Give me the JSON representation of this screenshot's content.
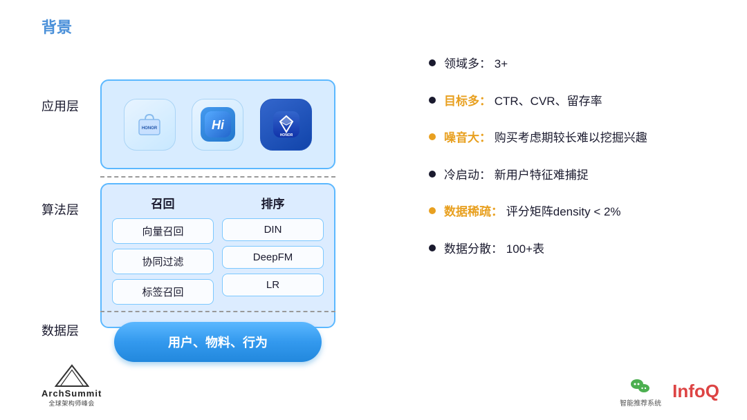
{
  "title": "背景",
  "layers": {
    "app": {
      "label": "应用层",
      "icons": [
        {
          "id": "honor-shop",
          "text": "HONOR",
          "style": "light"
        },
        {
          "id": "hihonor",
          "text": "Hi",
          "style": "blue"
        },
        {
          "id": "honor-diamond",
          "text": "HONOR",
          "style": "dark"
        }
      ]
    },
    "algo": {
      "label": "算法层",
      "recall": {
        "title": "召回",
        "items": [
          "向量召回",
          "协同过滤",
          "标签召回"
        ]
      },
      "rank": {
        "title": "排序",
        "items": [
          "DIN",
          "DeepFM",
          "LR"
        ]
      }
    },
    "data": {
      "label": "数据层",
      "content": "用户、物料、行为"
    }
  },
  "bullets": [
    {
      "id": "domains",
      "dot_color": "dark",
      "highlight": "",
      "prefix": "领域多：",
      "value": "3+"
    },
    {
      "id": "targets",
      "dot_color": "dark",
      "highlight": "orange",
      "prefix": "目标多：",
      "value": "CTR、CVR、留存率"
    },
    {
      "id": "noise",
      "dot_color": "orange",
      "highlight": "orange",
      "prefix": "噪音大：",
      "value": "购买考虑期较长难以挖掘兴趣"
    },
    {
      "id": "cold-start",
      "dot_color": "dark",
      "highlight": "",
      "prefix": "冷启动：",
      "value": "新用户特征难捕捉"
    },
    {
      "id": "sparse",
      "dot_color": "orange",
      "highlight": "orange",
      "prefix": "数据稀疏：",
      "value": "评分矩阵density < 2%"
    },
    {
      "id": "scattered",
      "dot_color": "dark",
      "highlight": "",
      "prefix": "数据分散：",
      "value": "100+表"
    }
  ],
  "bottom": {
    "archsummit": {
      "brand": "ArchSummit",
      "sub": "全球架构师峰会"
    },
    "infoq": {
      "wechat_label": "智能推荐系统",
      "brand": "InfoQ"
    }
  }
}
